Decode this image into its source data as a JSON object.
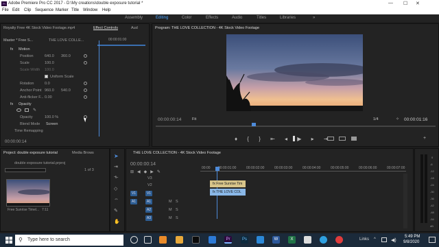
{
  "window": {
    "title": "Adobe Premiere Pro CC 2017 - D:\\My creations\\double exposure tutorial *",
    "min": "—",
    "max": "☐",
    "close": "✕"
  },
  "menu": [
    "File",
    "Edit",
    "Clip",
    "Sequence",
    "Marker",
    "Title",
    "Window",
    "Help"
  ],
  "workspaces": [
    "Assembly",
    "Editing",
    "Color",
    "Effects",
    "Audio",
    "Titles",
    "Libraries"
  ],
  "workspace_more": "»",
  "effect_controls": {
    "source_tab": "Royalty Free 4K Stock Video Footage.mp4",
    "tab": "Effect Controls",
    "tab2": "Aud",
    "master": "Master * Free S...",
    "clip": "THE LOVE COLLE...",
    "timecode_ruler": "00:00:01:00",
    "motion": "Motion",
    "fx": "fx",
    "position_label": "Position",
    "position_x": "640.0",
    "position_y": "360.0",
    "scale_label": "Scale",
    "scale": "100.0",
    "scale_width_label": "Scale Width",
    "scale_width": "100.0",
    "uniform_scale": "Uniform Scale",
    "rotation_label": "Rotation",
    "rotation": "0.0",
    "anchor_label": "Anchor Point",
    "anchor_x": "960.0",
    "anchor_y": "540.0",
    "antiflicker_label": "Anti-flicker F...",
    "antiflicker": "0.00",
    "opacity_section": "Opacity",
    "opacity_label": "Opacity",
    "opacity": "100.0 %",
    "blend_label": "Blend Mode",
    "blend": "Screen",
    "time_remap": "Time Remapping",
    "current_time": "00:00:00:14"
  },
  "program": {
    "title": "Program: THE LOVE COLLECTION - 4K Stock Video Footage",
    "timecode": "00:00:00:14",
    "fit": "Fit",
    "resolution": "1/4",
    "duration": "00:00:01:16"
  },
  "project": {
    "tab": "Project: double exposure tutorial",
    "tab2": "Media Brows",
    "file": "double exposure tutorial.prproj",
    "count": "1 of 3",
    "thumb_label": "Free Sunrise Timel...",
    "thumb_duration": "7:11"
  },
  "timeline": {
    "tab": "THE LOVE COLLECTION - 4K Stock Video Footage",
    "timecode": "00:00:00:14",
    "ruler": [
      "00:00",
      "00:00:01:00",
      "00:00:02:00",
      "00:00:03:00",
      "00:00:04:00",
      "00:00:05:00",
      "00:00:06:00",
      "00:00:07:00"
    ],
    "tracks": [
      "V3",
      "V2",
      "V1",
      "A1",
      "A2",
      "A3"
    ],
    "clip_v2": "Free Sunrise Tim",
    "clip_v1": "THE LOVE COL",
    "track_source_v": "V1",
    "track_source_a": "A1",
    "mute": "M",
    "solo": "S",
    "fx": "fx"
  },
  "audio_meter": {
    "labels": [
      "0",
      "-6",
      "-12",
      "-18",
      "-24",
      "-30",
      "-36",
      "-42",
      "-48",
      "-54"
    ],
    "db": "dB"
  },
  "taskbar": {
    "search": "Type here to search",
    "time": "5:49 PM",
    "date": "9/8/2020",
    "links": "Links",
    "premiere_label": "Pr",
    "photoshop_label": "Ps",
    "word_label": "W",
    "excel_label": "X",
    "expand": "^"
  }
}
